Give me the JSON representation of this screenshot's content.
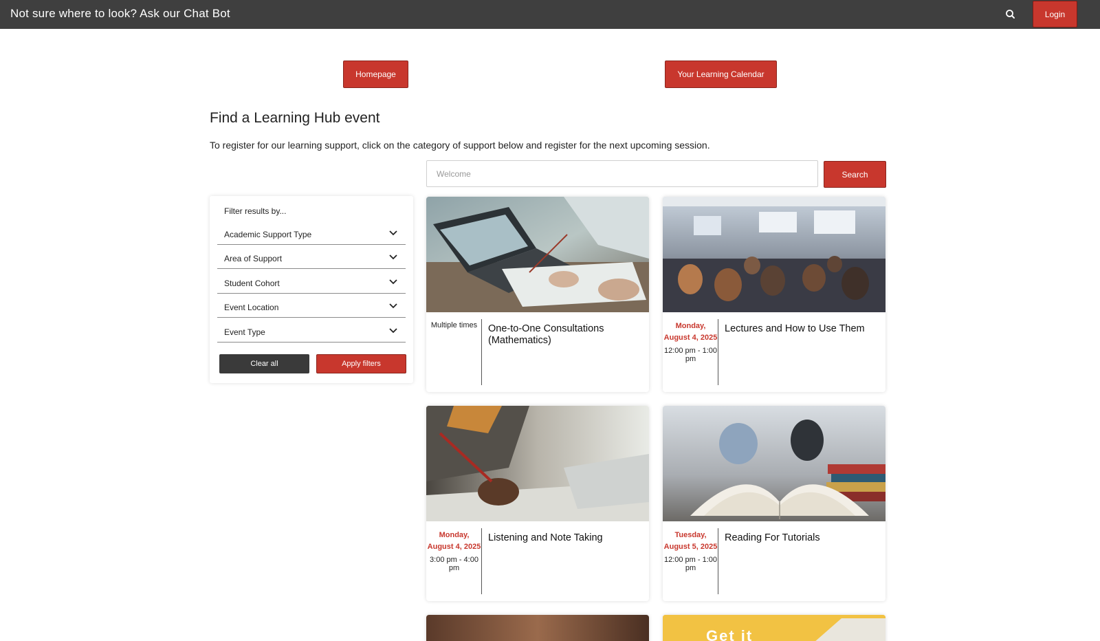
{
  "topbar": {
    "chat_label": "Not sure where to look? Ask our Chat Bot",
    "search_icon": "search-icon",
    "login_label": "Login"
  },
  "nav": {
    "homepage_label": "Homepage",
    "calendar_label": "Your Learning Calendar"
  },
  "main": {
    "title": "Find a Learning Hub event",
    "intro": "To register for our learning support, click on the category of support below and register for the next upcoming session."
  },
  "search": {
    "placeholder": "Welcome",
    "button_label": "Search"
  },
  "filters": {
    "title": "Filter results by...",
    "items": [
      {
        "label": "Academic Support Type"
      },
      {
        "label": "Area of Support"
      },
      {
        "label": "Student Cohort"
      },
      {
        "label": "Event Location"
      },
      {
        "label": "Event Type"
      }
    ],
    "clear_label": "Clear all",
    "apply_label": "Apply filters"
  },
  "events": [
    {
      "title": "One-to-One Consultations (Mathematics)",
      "multi": "Multiple times",
      "date": "",
      "time": "",
      "image": "laptop-notes-photo"
    },
    {
      "title": "Lectures and How to Use Them",
      "multi": "",
      "date": "Monday, August 4, 2025",
      "time": "12:00 pm - 1:00 pm",
      "image": "lecture-hall-photo"
    },
    {
      "title": "Listening and Note Taking",
      "multi": "",
      "date": "Monday, August 4, 2025",
      "time": "3:00 pm - 4:00 pm",
      "image": "writing-notes-photo"
    },
    {
      "title": "Reading For Tutorials",
      "multi": "",
      "date": "Tuesday, August 5, 2025",
      "time": "12:00 pm - 1:00 pm",
      "image": "open-book-photo"
    }
  ],
  "partial_cards": {
    "right_banner_text": "Get it"
  },
  "colors": {
    "topbar": "#3f3f3f",
    "accent": "#c8372d",
    "dark_button": "#3a3a3a"
  }
}
